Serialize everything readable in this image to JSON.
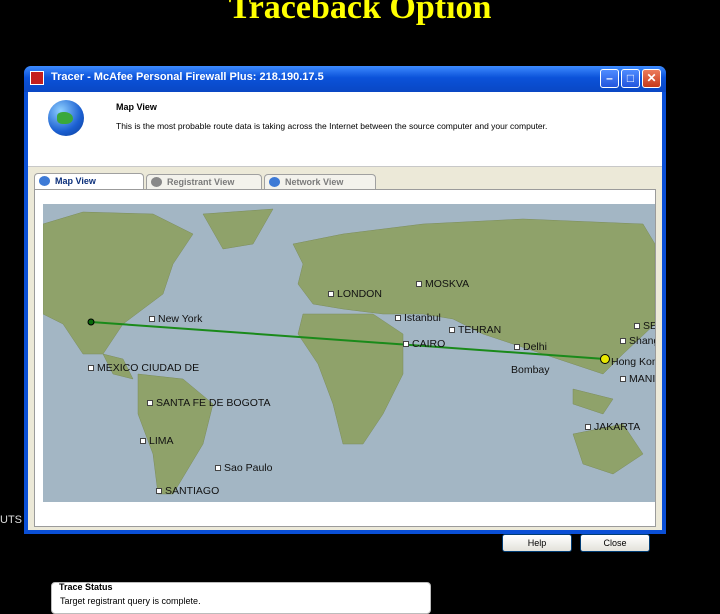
{
  "slide": {
    "title": "Traceback Option",
    "side_text": "UTS"
  },
  "window": {
    "title": "Tracer - McAfee Personal Firewall Plus:  218.190.17.5"
  },
  "header": {
    "title": "Map View",
    "description": "This is the most probable route data is taking across the Internet between the source computer and your computer."
  },
  "tabs": [
    {
      "label": "Map View",
      "active": true
    },
    {
      "label": "Registrant View",
      "active": false
    },
    {
      "label": "Network View",
      "active": false
    }
  ],
  "map": {
    "cities": [
      "LONDON",
      "MOSKVA",
      "New York",
      "Istanbul",
      "TEHRAN",
      "SE",
      "Shang",
      "CAIRO",
      "Delhi",
      "Hong Kon",
      "MEXICO CIUDAD DE",
      "Bombay",
      "MANI",
      "SANTA FE DE BOGOTA",
      "LIMA",
      "JAKARTA",
      "Sao Paulo",
      "SANTIAGO"
    ],
    "colors": {
      "ocean": "#a3b6c4",
      "land": "#8fa26a",
      "route": "#1a8a1a",
      "endpoint": "#e8e800"
    }
  },
  "status": {
    "title": "Trace Status",
    "message": "Target registrant query is complete."
  },
  "buttons": {
    "help": "Help",
    "close": "Close"
  },
  "icons": [
    "app-icon",
    "minimize-icon",
    "maximize-icon",
    "close-icon",
    "globe-icon",
    "map-view-tab-icon",
    "registrant-view-tab-icon",
    "network-view-tab-icon"
  ]
}
